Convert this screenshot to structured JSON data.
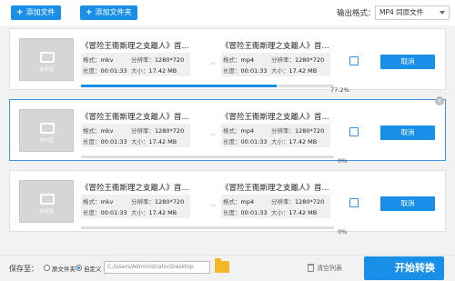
{
  "toolbar": {
    "add_file_label": "添加文件",
    "add_folder_label": "添加文件夹",
    "output_format_label": "输出格式：",
    "output_format_value": "MP4  同原文件"
  },
  "tasks": [
    {
      "source_title": "《冒险王衞斯理之支離人》首...",
      "target_title": "《冒险王衞斯理之支離人》首...",
      "format_label": "格式：",
      "source_format": "mkv",
      "target_format": "mp4",
      "resolution_label": "分辨率：",
      "source_resolution": "1280*720",
      "target_resolution": "1280*720",
      "duration_label": "长度：",
      "source_duration": "00:01:33",
      "target_duration": "00:01:33",
      "size_label": "大小：",
      "source_size": "17.42 MB",
      "target_size": "17.42 MB",
      "progress_percent": 77.2,
      "progress_text": "77.2%",
      "cancel_label": "取消",
      "thumb_caption": "软件园"
    },
    {
      "source_title": "《冒险王衞斯理之支離人》首...",
      "target_title": "《冒险王衞斯理之支離人》首...",
      "format_label": "格式：",
      "source_format": "mkv",
      "target_format": "mp4",
      "resolution_label": "分辨率：",
      "source_resolution": "1280*720",
      "target_resolution": "1280*720",
      "duration_label": "长度：",
      "source_duration": "00:01:33",
      "target_duration": "00:01:33",
      "size_label": "大小：",
      "source_size": "17.42 MB",
      "target_size": "17.42 MB",
      "progress_percent": 0,
      "progress_text": "0%",
      "cancel_label": "取消",
      "thumb_caption": "软件园"
    },
    {
      "source_title": "《冒险王衞斯理之支離人》首...",
      "target_title": "《冒险王衞斯理之支離人》首...",
      "format_label": "格式：",
      "source_format": "mkv",
      "target_format": "mp4",
      "resolution_label": "分辨率：",
      "source_resolution": "1280*720",
      "target_resolution": "1280*720",
      "duration_label": "长度：",
      "source_duration": "00:01:33",
      "target_duration": "00:01:33",
      "size_label": "大小：",
      "source_size": "17.42 MB",
      "target_size": "17.42 MB",
      "progress_percent": 0,
      "progress_text": "0%",
      "cancel_label": "取消",
      "thumb_caption": "软件园"
    }
  ],
  "bottom": {
    "save_to_label": "保存至：",
    "option_source_folder": "原文件夹",
    "option_custom": "自定义",
    "path_value": "C:/Users/Administrator/Desktop",
    "clear_list_label": "清空列表",
    "start_label": "开始转换"
  },
  "colors": {
    "accent": "#1a8fe8",
    "selected_border": "#3a93e6",
    "list_background": "#f2f2f2"
  }
}
